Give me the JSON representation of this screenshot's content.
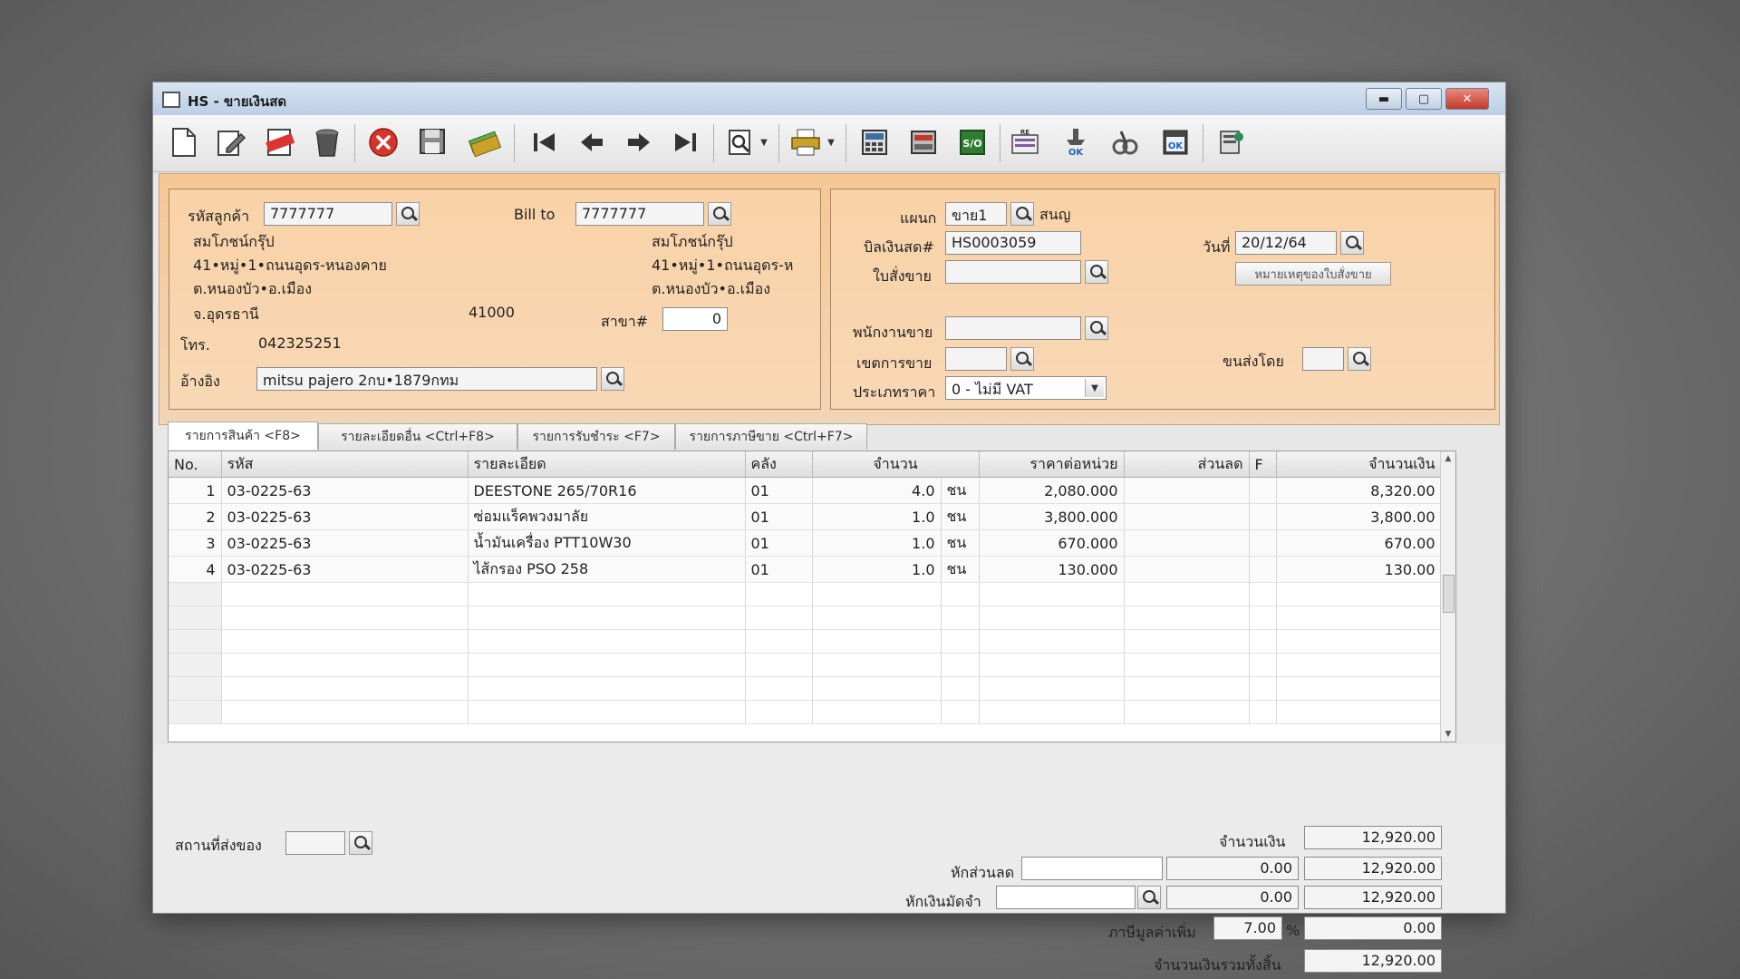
{
  "window": {
    "title": "HS - ขายเงินสด"
  },
  "customer": {
    "code_label": "รหัสลูกค้า",
    "code": "7777777",
    "bill_to_label": "Bill to",
    "bill_to": "7777777",
    "name": "สมโภชน์กรุ๊ป",
    "addr1": "41•หมู่•1•ถนนอุดร-หนองคาย",
    "addr2": "ต.หนองบัว•อ.เมือง",
    "addr3": "จ.อุดรธานี",
    "zip": "41000",
    "bill_name": "สมโภชน์กรุ๊ป",
    "bill_addr1": "41•หมู่•1•ถนนอุดร-ห",
    "bill_addr2": "ต.หนองบัว•อ.เมือง",
    "branch_label": "สาขา#",
    "branch": "0",
    "phone_label": "โทร.",
    "phone": "042325251",
    "ref_label": "อ้างอิง",
    "ref": "mitsu pajero 2กบ•1879กทม"
  },
  "sale": {
    "dept_label": "แผนก",
    "dept": "ขาย1",
    "dept_name": "สนญ",
    "bill_label": "บิลเงินสด#",
    "bill": "HS0003059",
    "date_label": "วันที่",
    "date": "20/12/64",
    "order_label": "ใบสั่งขาย",
    "order": "",
    "order_note": "หมายเหตุของใบสั่งขาย",
    "staff_label": "พนักงานขาย",
    "staff": "",
    "zone_label": "เขตการขาย",
    "zone": "",
    "ship_by_label": "ขนส่งโดย",
    "ship_by": "",
    "price_type_label": "ประเภทราคา",
    "price_type": "0 - ไม่มี VAT"
  },
  "tabs": [
    {
      "label": "รายการสินค้า <F8>"
    },
    {
      "label": "รายละเอียดอื่น <Ctrl+F8>"
    },
    {
      "label": "รายการรับชำระ <F7>"
    },
    {
      "label": "รายการภาษีขาย <Ctrl+F7>"
    }
  ],
  "table": {
    "headers": [
      "No.",
      "รหัส",
      "รายละเอียด",
      "คลัง",
      "จำนวน",
      "ราคาต่อหน่วย",
      "ส่วนลด",
      "F",
      "จำนวนเงิน"
    ],
    "rows": [
      {
        "no": "1",
        "code": "03-0225-63",
        "desc": "DEESTONE 265/70R16",
        "wh": "01",
        "qty": "4.0",
        "unit": "ชน",
        "price": "2,080.000",
        "disc": "",
        "f": "",
        "amount": "8,320.00"
      },
      {
        "no": "2",
        "code": "03-0225-63",
        "desc": "ซ่อมแร็คพวงมาลัย",
        "wh": "01",
        "qty": "1.0",
        "unit": "ชน",
        "price": "3,800.000",
        "disc": "",
        "f": "",
        "amount": "3,800.00"
      },
      {
        "no": "3",
        "code": "03-0225-63",
        "desc": "น้ำมันเครื่อง PTT10W30",
        "wh": "01",
        "qty": "1.0",
        "unit": "ชน",
        "price": "670.000",
        "disc": "",
        "f": "",
        "amount": "670.00"
      },
      {
        "no": "4",
        "code": "03-0225-63",
        "desc": "ไส้กรอง PSO 258",
        "wh": "01",
        "qty": "1.0",
        "unit": "ชน",
        "price": "130.000",
        "disc": "",
        "f": "",
        "amount": "130.00"
      }
    ]
  },
  "totals": {
    "ship_place_label": "สถานที่ส่งของ",
    "ship_place": "",
    "amount_label": "จำนวนเงิน",
    "amount": "12,920.00",
    "discount_label": "หักส่วนลด",
    "discount_value": "0.00",
    "after_discount": "12,920.00",
    "deposit_label": "หักเงินมัดจำ",
    "deposit_value": "0.00",
    "after_deposit": "12,920.00",
    "vat_label": "ภาษีมูลค่าเพิ่ม",
    "vat_rate": "7.00",
    "vat_pct": "%",
    "vat_amount": "0.00",
    "grand_label": "จำนวนเงินรวมทั้งสิ้น",
    "grand_total": "12,920.00"
  }
}
